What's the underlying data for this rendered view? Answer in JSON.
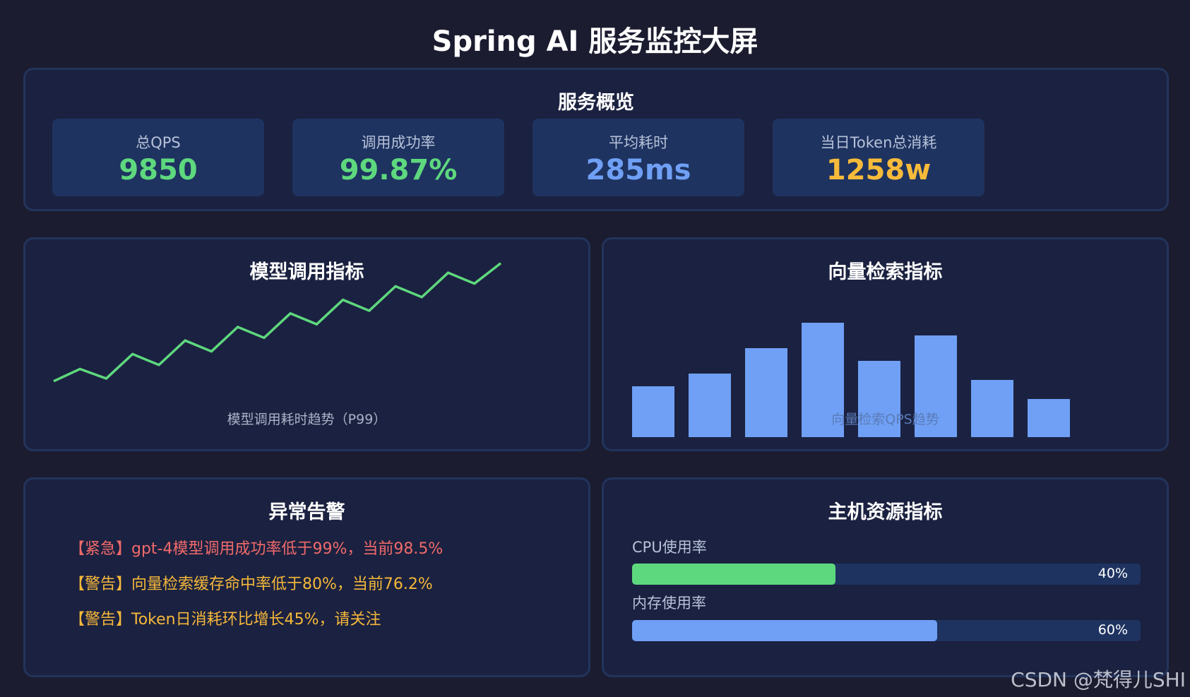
{
  "page": {
    "title": "Spring AI 服务监控大屏"
  },
  "overview": {
    "title": "服务概览",
    "stats": [
      {
        "label": "总QPS",
        "value": "9850",
        "color": "#5ed87e"
      },
      {
        "label": "调用成功率",
        "value": "99.87%",
        "color": "#5ed87e"
      },
      {
        "label": "平均耗时",
        "value": "285ms",
        "color": "#6fa0f5"
      },
      {
        "label": "当日Token总消耗",
        "value": "1258w",
        "color": "#f7bb3a"
      }
    ]
  },
  "model_panel": {
    "title": "模型调用指标",
    "caption": "模型调用耗时趋势（P99）"
  },
  "vector_panel": {
    "title": "向量检索指标",
    "caption": "向量检索QPS趋势"
  },
  "chart_data": [
    {
      "type": "line",
      "title": "模型调用耗时趋势（P99）",
      "x": [
        1,
        2,
        3,
        4,
        5,
        6,
        7,
        8,
        9,
        10,
        11,
        12,
        13,
        14,
        15,
        16,
        17,
        18
      ],
      "values": [
        10,
        19,
        12,
        30,
        22,
        40,
        32,
        50,
        42,
        60,
        52,
        70,
        62,
        80,
        72,
        90,
        82,
        97
      ],
      "ylim": [
        0,
        100
      ],
      "color": "#5ed87e",
      "grid": false
    },
    {
      "type": "bar",
      "title": "向量检索QPS趋势",
      "categories": [
        "1",
        "2",
        "3",
        "4",
        "5",
        "6",
        "7",
        "8"
      ],
      "values": [
        40,
        50,
        70,
        90,
        60,
        80,
        45,
        30
      ],
      "ylim": [
        0,
        100
      ],
      "color": "#6fa0f5",
      "grid": false
    }
  ],
  "alerts": {
    "title": "异常告警",
    "items": [
      {
        "text": "【紧急】gpt-4模型调用成功率低于99%，当前98.5%",
        "level": "urgent"
      },
      {
        "text": "【警告】向量检索缓存命中率低于80%，当前76.2%",
        "level": "warning"
      },
      {
        "text": "【警告】Token日消耗环比增长45%，请关注",
        "level": "warning"
      }
    ]
  },
  "host": {
    "title": "主机资源指标",
    "resources": [
      {
        "label": "CPU使用率",
        "percent_text": "40%",
        "fraction": 0.4,
        "color": "#5ed87e"
      },
      {
        "label": "内存使用率",
        "percent_text": "60%",
        "fraction": 0.6,
        "color": "#6fa0f5"
      }
    ]
  },
  "watermark": "CSDN @梵得儿SHI"
}
